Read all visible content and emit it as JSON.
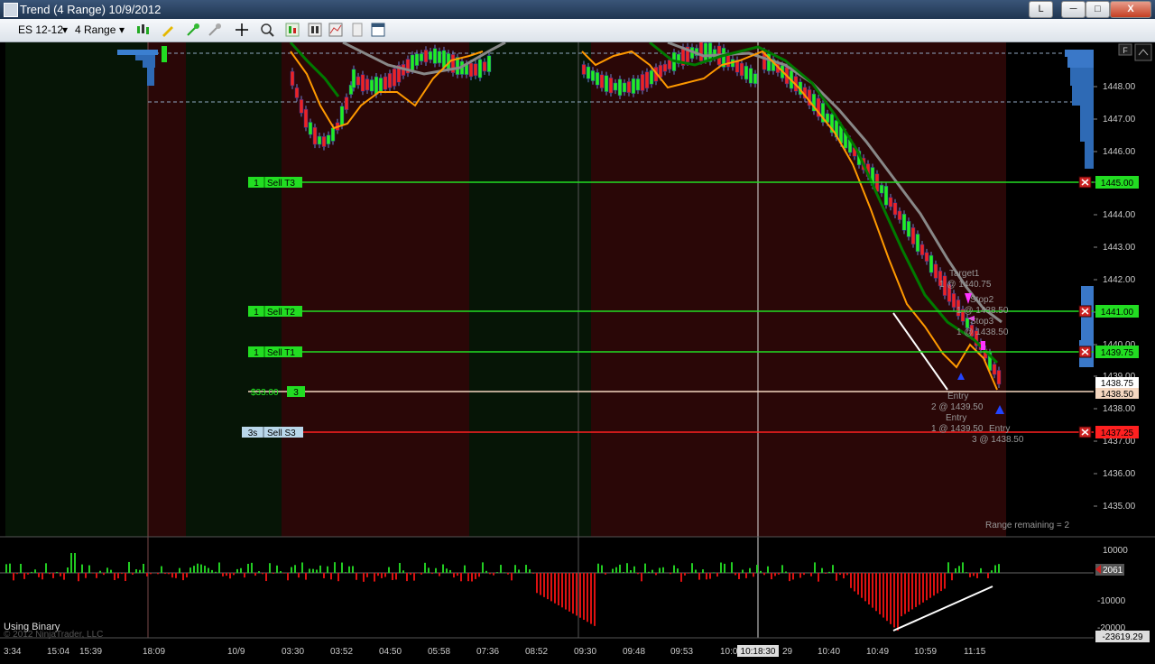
{
  "window": {
    "title": "Trend (4 Range)  10/9/2012",
    "btn_l": "L",
    "btn_min": "─",
    "btn_max": "□",
    "btn_close": "X"
  },
  "toolbar": {
    "instrument": "ES 12-12",
    "period": "4 Range"
  },
  "price_axis": {
    "labels": [
      "1448.00",
      "1447.00",
      "1446.00",
      "1445.00",
      "1444.00",
      "1443.00",
      "1442.00",
      "1441.00",
      "1440.00",
      "1439.00",
      "1438.75",
      "1438.50",
      "1438.00",
      "1437.25",
      "1437.00",
      "1436.00",
      "1435.00"
    ],
    "tag_1445": "1445.00",
    "tag_1441": "1441.00",
    "tag_1439_75": "1439.75",
    "tag_1438_75": "1438.75",
    "tag_1438_50": "1438.50",
    "tag_1437_25": "1437.25"
  },
  "orders": {
    "sell_t3": {
      "qty": "1",
      "label": "Sell T3"
    },
    "sell_t2": {
      "qty": "1",
      "label": "Sell T2"
    },
    "sell_t1": {
      "qty": "1",
      "label": "Sell T1"
    },
    "position": {
      "pnl": "$33.00",
      "qty": "3"
    },
    "sell_s3": {
      "qty": "3s",
      "label": "Sell S3"
    }
  },
  "annotations": {
    "target1": "Target1",
    "target1_detail": "1 @ 1440.75",
    "stop2": "Stop2",
    "stop2_detail": "1 @ 1438.50",
    "stop3": "Stop3",
    "stop3_detail": "1 @ 1438.50",
    "entry1": "Entry",
    "entry1_detail": "2 @ 1439.50",
    "entry2": "Entry",
    "entry2_detail": "1 @ 1439.50",
    "entry3": "Entry",
    "entry3_detail": "3 @ 1438.50",
    "range_remaining": "Range remaining = 2"
  },
  "indicator": {
    "axis_labels": [
      "10000",
      "-10000",
      "-20000"
    ],
    "current": "2061",
    "min_value": "-23619.29",
    "status": "Using Binary",
    "copyright": "© 2012 NinjaTrader, LLC"
  },
  "time_axis": {
    "labels": [
      "3:34",
      "15:04",
      "15:39",
      "18:09",
      "10/9",
      "03:30",
      "03:52",
      "04:50",
      "05:58",
      "07:36",
      "08:52",
      "09:30",
      "09:48",
      "09:53",
      "10:0",
      "29",
      "10:40",
      "10:49",
      "10:59",
      "11:15"
    ],
    "cursor": "10:18:30"
  },
  "colors": {
    "target_line": "#22cc22",
    "stop_line": "#ff2020",
    "entry_line": "#f5d7c0",
    "ema_fast": "#ff9900",
    "ema_mid": "#008000",
    "ema_slow": "#888888",
    "bg_red_zone": "#2a0707",
    "bg_green_zone": "#061506"
  }
}
